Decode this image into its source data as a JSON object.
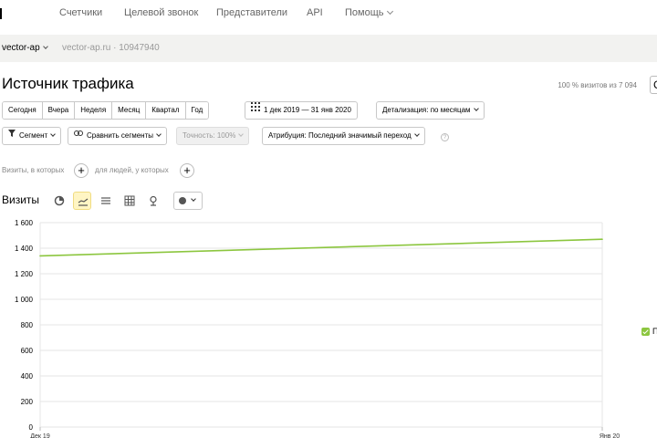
{
  "nav": {
    "items": [
      {
        "label": "Счетчики"
      },
      {
        "label": "Целевой звонок"
      },
      {
        "label": "Представители"
      },
      {
        "label": "API"
      },
      {
        "label": "Помощь"
      }
    ]
  },
  "counter": {
    "name": "vector-ap",
    "site": "vector-ap.ru · 10947940"
  },
  "page": {
    "title": "Источник трафика",
    "visits_share": "100 % визитов из 7 094",
    "right_box_char": "С"
  },
  "period": {
    "options": [
      "Сегодня",
      "Вчера",
      "Неделя",
      "Месяц",
      "Квартал",
      "Год"
    ],
    "date_range": "1 дек 2019 — 31 янв 2020",
    "detail": "Детализация: по месяцам"
  },
  "toolbar": {
    "segment": "Сегмент",
    "compare": "Сравнить сегменты",
    "accuracy": "Точность: 100%",
    "attribution": "Атрибуция: Последний значимый переход",
    "help": "?"
  },
  "filter": {
    "visits_label": "Визиты, в которых",
    "people_label": "для людей, у которых",
    "plus": "+"
  },
  "chart_header": {
    "label": "Визиты",
    "tool_icons": [
      "pie-chart-icon",
      "line-chart-icon",
      "stacked-area-icon",
      "table-icon",
      "map-pin-icon",
      "bubble-icon"
    ]
  },
  "legend": {
    "text": "П"
  },
  "colors": {
    "series": "#8cc63f",
    "active_tool": "#fff5c4"
  },
  "chart_data": {
    "type": "line",
    "x": [
      "Дек 19",
      "Янв 20"
    ],
    "x_tick_labels": [
      "Дек 19",
      "Янв 20"
    ],
    "series": [
      {
        "values": [
          1340,
          1470
        ]
      }
    ],
    "ylim": [
      0,
      1600
    ],
    "yticks": [
      0,
      200,
      400,
      600,
      800,
      1000,
      1200,
      1400,
      1600
    ],
    "ytick_labels": [
      "0",
      "200",
      "400",
      "600",
      "800",
      "1 000",
      "1 200",
      "1 400",
      "1 600"
    ],
    "grid": true,
    "legend_position": "right"
  }
}
